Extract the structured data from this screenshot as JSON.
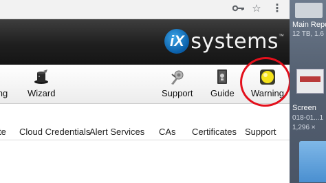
{
  "browser": {
    "key_icon": "key-icon",
    "star_icon": "star-icon",
    "menu_icon": "kebab-menu-icon"
  },
  "header": {
    "logo_mark": "iX",
    "logo_text": "systems",
    "logo_tm": "™"
  },
  "toolbar": {
    "items": [
      {
        "label": "ng",
        "icon": "settings-icon"
      },
      {
        "label": "Wizard",
        "icon": "wizard-hat-icon"
      },
      {
        "label": "Support",
        "icon": "support-icon"
      },
      {
        "label": "Guide",
        "icon": "guide-book-icon"
      },
      {
        "label": "Warning",
        "icon": "warning-light-icon"
      }
    ]
  },
  "tabs": [
    "te",
    "Cloud Credentials",
    "Alert Services",
    "CAs",
    "Certificates",
    "Support"
  ],
  "desktop": {
    "item1_title": "Main Repo",
    "item1_sub": "12 TB, 1.6",
    "item2_title": "Screen",
    "item2_sub1": "018-01...1",
    "item2_sub2": "1,296 ×"
  },
  "colors": {
    "annotation": "#e3101c",
    "warning_light": "#f5e21a",
    "header_bg": "#1f1f1f"
  }
}
